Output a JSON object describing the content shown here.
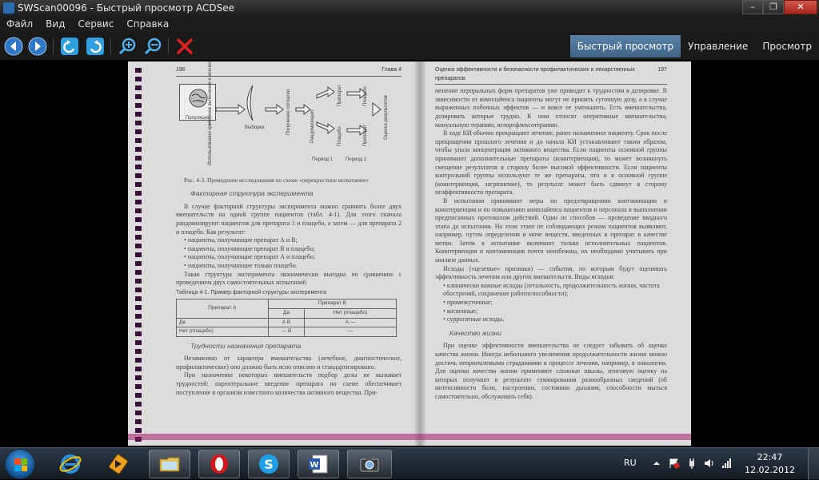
{
  "window": {
    "title": "SWScan00096 - Быстрый просмотр ACDSee",
    "minimize_label": "–",
    "maximize_label": "❐",
    "close_label": "✕"
  },
  "menu": {
    "items": [
      "Файл",
      "Вид",
      "Сервис",
      "Справка"
    ]
  },
  "toolbar": {
    "icons": [
      "back-icon",
      "forward-icon",
      "rotate-left-icon",
      "rotate-right-icon",
      "zoom-in-icon",
      "zoom-out-icon",
      "delete-icon"
    ],
    "colors": {
      "nav": "#2f78c8",
      "rotate": "#2f9fe0",
      "delete": "#e02020",
      "active_tab": "#4f769c"
    }
  },
  "mode_tabs": [
    {
      "label": "Быстрый просмотр",
      "active": true
    },
    {
      "label": "Управление",
      "active": false
    },
    {
      "label": "Просмотр",
      "active": false
    }
  ],
  "scan": {
    "left_page": {
      "page_number": "196",
      "chapter": "Глава 4",
      "figure": {
        "population": "Популяция",
        "sample": "Выборка",
        "consent": "Использование критериев включения и исключения",
        "informed_consent": "Получение согласия",
        "randomization": "Рандомизация",
        "drug": "Препарат",
        "placebo": "Плацебо",
        "outcome": "Оценка результатов",
        "period1": "Период 1",
        "period2": "Период 2"
      },
      "caption": "Рис. 4-3. Проведение исследования по схеме «перекрестное испытание»",
      "section1": "Факторная структура эксперимента",
      "para1": "В случае факторной структуры эксперимента можно сравнить более двух вмешательств на одной группе пациентов (табл. 4-1). Для этого сначала рандомизируют пациентов для препарата 1 и плацебо, а затем — для препарата 2 и плацебо. Как результат:",
      "bullets": [
        "пациенты, получающие препарат А и В;",
        "пациенты, получающие препарат В и плацебо;",
        "пациенты, получающие препарат А и плацебо;",
        "пациенты, получающие только плацебо."
      ],
      "para2": "Такая структура эксперимента экономически выгодна по сравнению с проведением двух самостоятельных испытаний.",
      "table_caption": "Таблица 4-1. Пример факторной структуры эксперимента",
      "table": {
        "h_a": "Препарат А",
        "h_b": "Препарат В",
        "h_yes": "Да",
        "h_no": "Нет (плацебо)",
        "r1_label": "Да",
        "r1_yes": "А В",
        "r1_no": "А —",
        "r2_label": "Нет (плацебо)",
        "r2_yes": "— В",
        "r2_no": "—"
      },
      "section2": "Трудности назначения препарата",
      "para3": "Независимо от характера вмешательства (лечебное, диагностическое, профилактическое) оно должно быть ясно описано и стандартизировано.",
      "para4": "При назначении некоторых вмешательств подбор дозы не вызывает трудностей: парентеральное введение препарата по схеме обеспечивает поступление в организм известного количества активного вещества. При-"
    },
    "right_page": {
      "running_head": "Оценка эффективности и безопасности профилактических и лекарственных препаратов",
      "page_number": "197",
      "p1": "менение пероральных форм препаратов уже приводит к трудностям в дозировке. В зависимости от комплайенса пациенты могут не принять суточную дозу, а в случае выраженных побочных эффектов — и вовсе ее уменьшить. Есть вмешательства, дозировать которые трудно. К ним относят оперативные вмешательства, мануальную терапию, иглорефлексотерапию.",
      "p2": "В ходе КИ обычно прекращают лечение, ранее назначенное пациенту. Срок после прекращения прошлого лечения и до начала КИ устанавливают таким образом, чтобы упала концентрация активного вещества. Если пациенты основной группы принимают дополнительные препараты (коинтервенция), то может возникнуть смещение результатов в сторону более высокой эффективности. Если пациенты контрольной группы используют те же препараты, что и в основной группе (коинтервенция, загрязнение), то результат может быть сдвинут в сторону неэффективности препарата.",
      "p3": "В испытании принимают меры по предотвращению контаминации и коинтервенции и по повышению комплайенса пациентов и персонала в выполнении предписанных протоколом действий. Один из способов — проведение вводного этапа до испытания. На этом этапе не соблюдающих режим пациентов выявляют, например, путем определения в моче веществ, введенных в препарат в качестве метки. Затем в испытание включают только исполнительных пациентов. Коинтервенция и контаминация почти неизбежны, их необходимо учитывать при анализе данных.",
      "p4": "Исходы («целевые» признаки) — события, по которым будут оценивать эффективность лечения или других вмешательств. Виды исходов:",
      "bullets": [
        "клинически важные исходы (летальность, продолжительность жизни, частота обострений, сохранение работоспособности);",
        "промежуточные;",
        "косвенные;",
        "суррогатные исходы."
      ],
      "section": "Качество жизни",
      "p5": "При оценке эффективности вмешательства не следует забывать об оценке качества жизни. Иногда небольшого увеличения продолжительности жизни можно достичь неприемлемыми страданиями в процессе лечения, например, в онкологии. Для оценки качества жизни применяют сложные шкалы, итоговую оценку на которых получают в результате суммирования разнообразных сведений (об интенсивности боли, настроении, состоянии дыхания, способности мыться самостоятельно, обслуживать себя)."
    }
  },
  "taskbar": {
    "apps": [
      {
        "name": "internet-explorer-icon",
        "open": false
      },
      {
        "name": "media-player-icon",
        "open": false
      },
      {
        "name": "file-explorer-icon",
        "open": true
      },
      {
        "name": "opera-icon",
        "open": true
      },
      {
        "name": "skype-icon",
        "open": true
      },
      {
        "name": "word-icon",
        "open": true
      },
      {
        "name": "acdsee-icon",
        "open": true
      }
    ],
    "language": "RU",
    "time": "22:47",
    "date": "12.02.2012"
  }
}
